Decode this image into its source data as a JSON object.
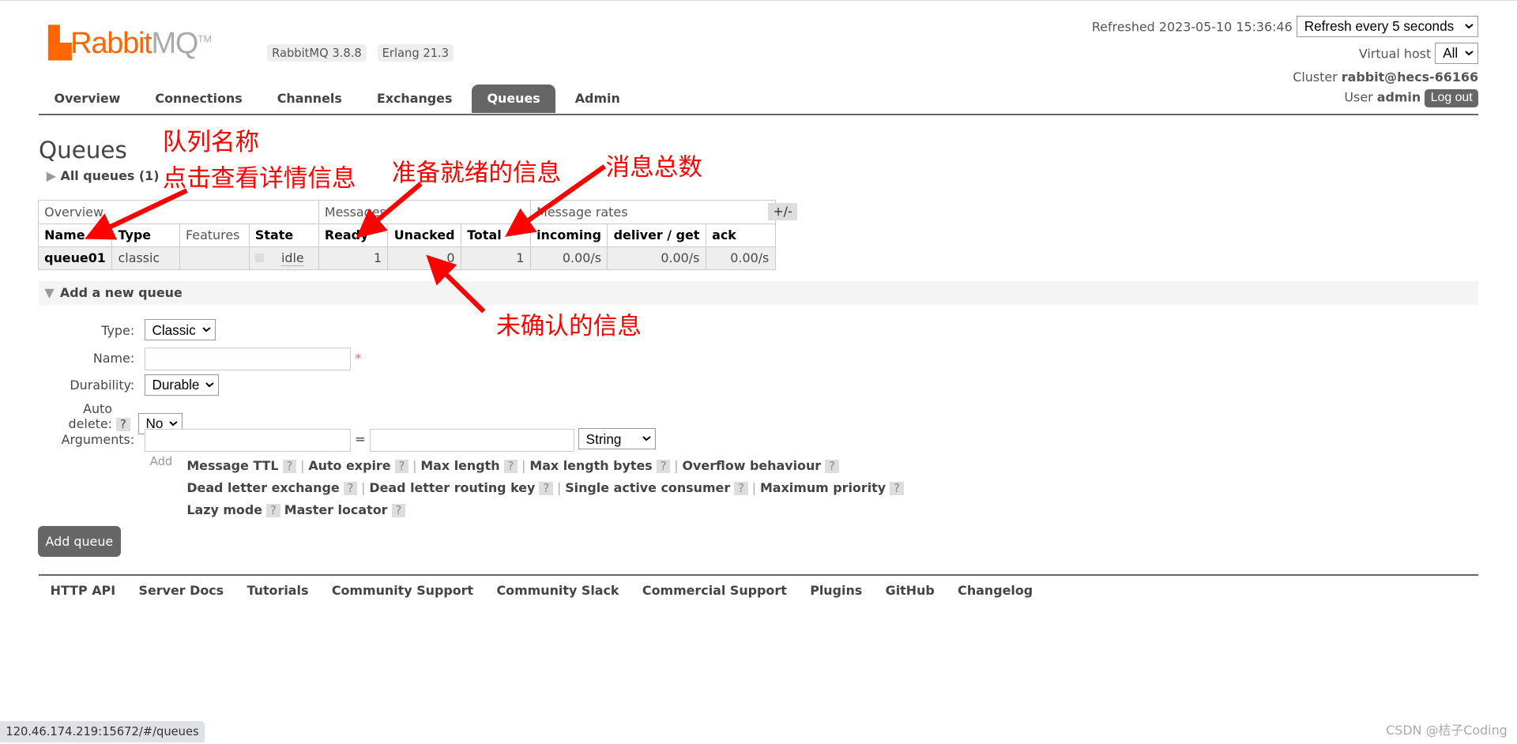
{
  "header": {
    "logo_text": "RabbitMQ",
    "logo_tm": "TM",
    "version": "RabbitMQ 3.8.8",
    "erlang": "Erlang 21.3",
    "refreshed": "Refreshed 2023-05-10 15:36:46",
    "refresh_select": "Refresh every 5 seconds",
    "vhost_label": "Virtual host",
    "vhost_value": "All",
    "cluster_label": "Cluster",
    "cluster_value": "rabbit@hecs-66166",
    "user_label": "User",
    "user_value": "admin",
    "logout": "Log out"
  },
  "nav": {
    "tabs": [
      "Overview",
      "Connections",
      "Channels",
      "Exchanges",
      "Queues",
      "Admin"
    ],
    "active": "Queues"
  },
  "page": {
    "title": "Queues",
    "all_queues": "All queues (1)",
    "plus_minus": "+/-"
  },
  "table": {
    "groups": [
      "Overview",
      "Messages",
      "Message rates"
    ],
    "columns": [
      "Name",
      "Type",
      "Features",
      "State",
      "Ready",
      "Unacked",
      "Total",
      "incoming",
      "deliver / get",
      "ack"
    ],
    "rows": [
      {
        "name": "queue01",
        "type": "classic",
        "features": "",
        "state": "idle",
        "ready": "1",
        "unacked": "0",
        "total": "1",
        "incoming": "0.00/s",
        "deliver_get": "0.00/s",
        "ack": "0.00/s"
      }
    ]
  },
  "add_queue": {
    "section_title": "Add a new queue",
    "type_label": "Type:",
    "type_value": "Classic",
    "name_label": "Name:",
    "name_value": "",
    "required_mark": "*",
    "durability_label": "Durability:",
    "durability_value": "Durable",
    "auto_delete_label": "Auto delete:",
    "auto_delete_value": "No",
    "arguments_label": "Arguments:",
    "equals": "=",
    "arg_type": "String",
    "add_label": "Add",
    "arg_shortcuts": [
      [
        "Message TTL",
        "Auto expire",
        "Max length",
        "Max length bytes",
        "Overflow behaviour"
      ],
      [
        "Dead letter exchange",
        "Dead letter routing key",
        "Single active consumer",
        "Maximum priority"
      ],
      [
        "Lazy mode",
        "Master locator"
      ]
    ],
    "help": "?",
    "submit": "Add queue"
  },
  "footer": {
    "links": [
      "HTTP API",
      "Server Docs",
      "Tutorials",
      "Community Support",
      "Community Slack",
      "Commercial Support",
      "Plugins",
      "GitHub",
      "Changelog"
    ]
  },
  "annotations": {
    "name": "队列名称",
    "click": "点击查看详情信息",
    "ready": "准备就绪的信息",
    "total": "消息总数",
    "unacked": "未确认的信息",
    "color": "#ff0000"
  },
  "status_url": "120.46.174.219:15672/#/queues",
  "watermark": "CSDN @桔子Coding"
}
